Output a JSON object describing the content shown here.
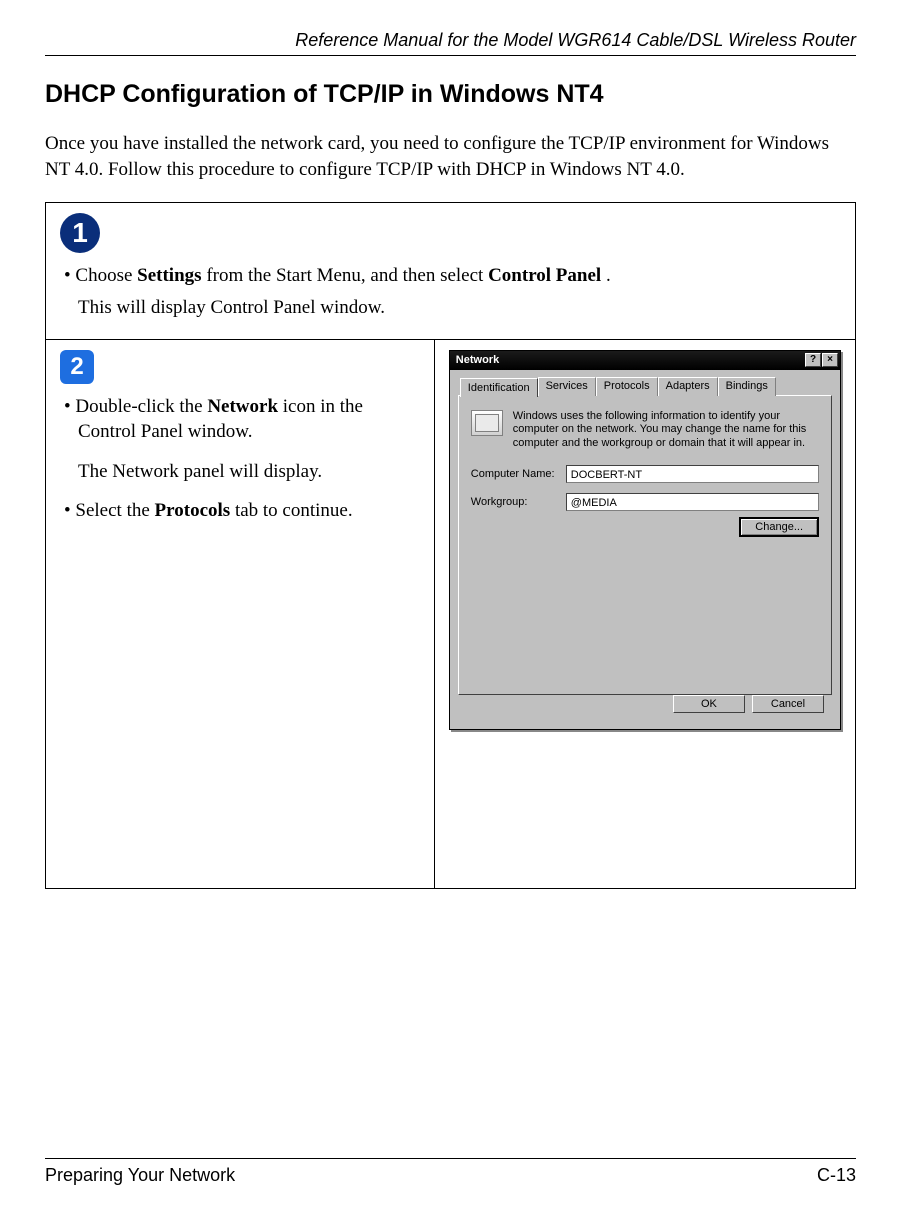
{
  "header": {
    "manual_title": "Reference Manual for the Model WGR614 Cable/DSL Wireless Router"
  },
  "title": "DHCP Configuration of TCP/IP in Windows NT4",
  "intro": "Once you have installed the network card, you need to configure the TCP/IP environment for Windows NT 4.0. Follow this procedure to configure TCP/IP with DHCP in Windows NT 4.0.",
  "step1": {
    "num": "1",
    "line1_pre": "Choose ",
    "line1_b1": "Settings",
    "line1_mid": " from the Start Menu, and then select ",
    "line1_b2": "Control Panel",
    "line1_post": ".",
    "line2": "This will display Control Panel window."
  },
  "step2": {
    "num": "2",
    "b1_pre": "Double-click the ",
    "b1_bold": "Network",
    "b1_post": " icon in the Control Panel window.",
    "b1_after": "The Network panel will display.",
    "b2_pre": "Select the ",
    "b2_bold": "Protocols",
    "b2_post": " tab to continue."
  },
  "dialog": {
    "title": "Network",
    "help_btn": "?",
    "close_btn": "×",
    "tabs": {
      "identification": "Identification",
      "services": "Services",
      "protocols": "Protocols",
      "adapters": "Adapters",
      "bindings": "Bindings"
    },
    "info_text": "Windows uses the following information to identify your computer on the network. You may change the name for this computer and the workgroup or domain that it will appear in.",
    "fields": {
      "computer_name_label": "Computer Name:",
      "computer_name_value": "DOCBERT-NT",
      "workgroup_label": "Workgroup:",
      "workgroup_value": "@MEDIA"
    },
    "buttons": {
      "change": "Change...",
      "ok": "OK",
      "cancel": "Cancel"
    }
  },
  "footer": {
    "section": "Preparing Your Network",
    "page": "C-13"
  }
}
